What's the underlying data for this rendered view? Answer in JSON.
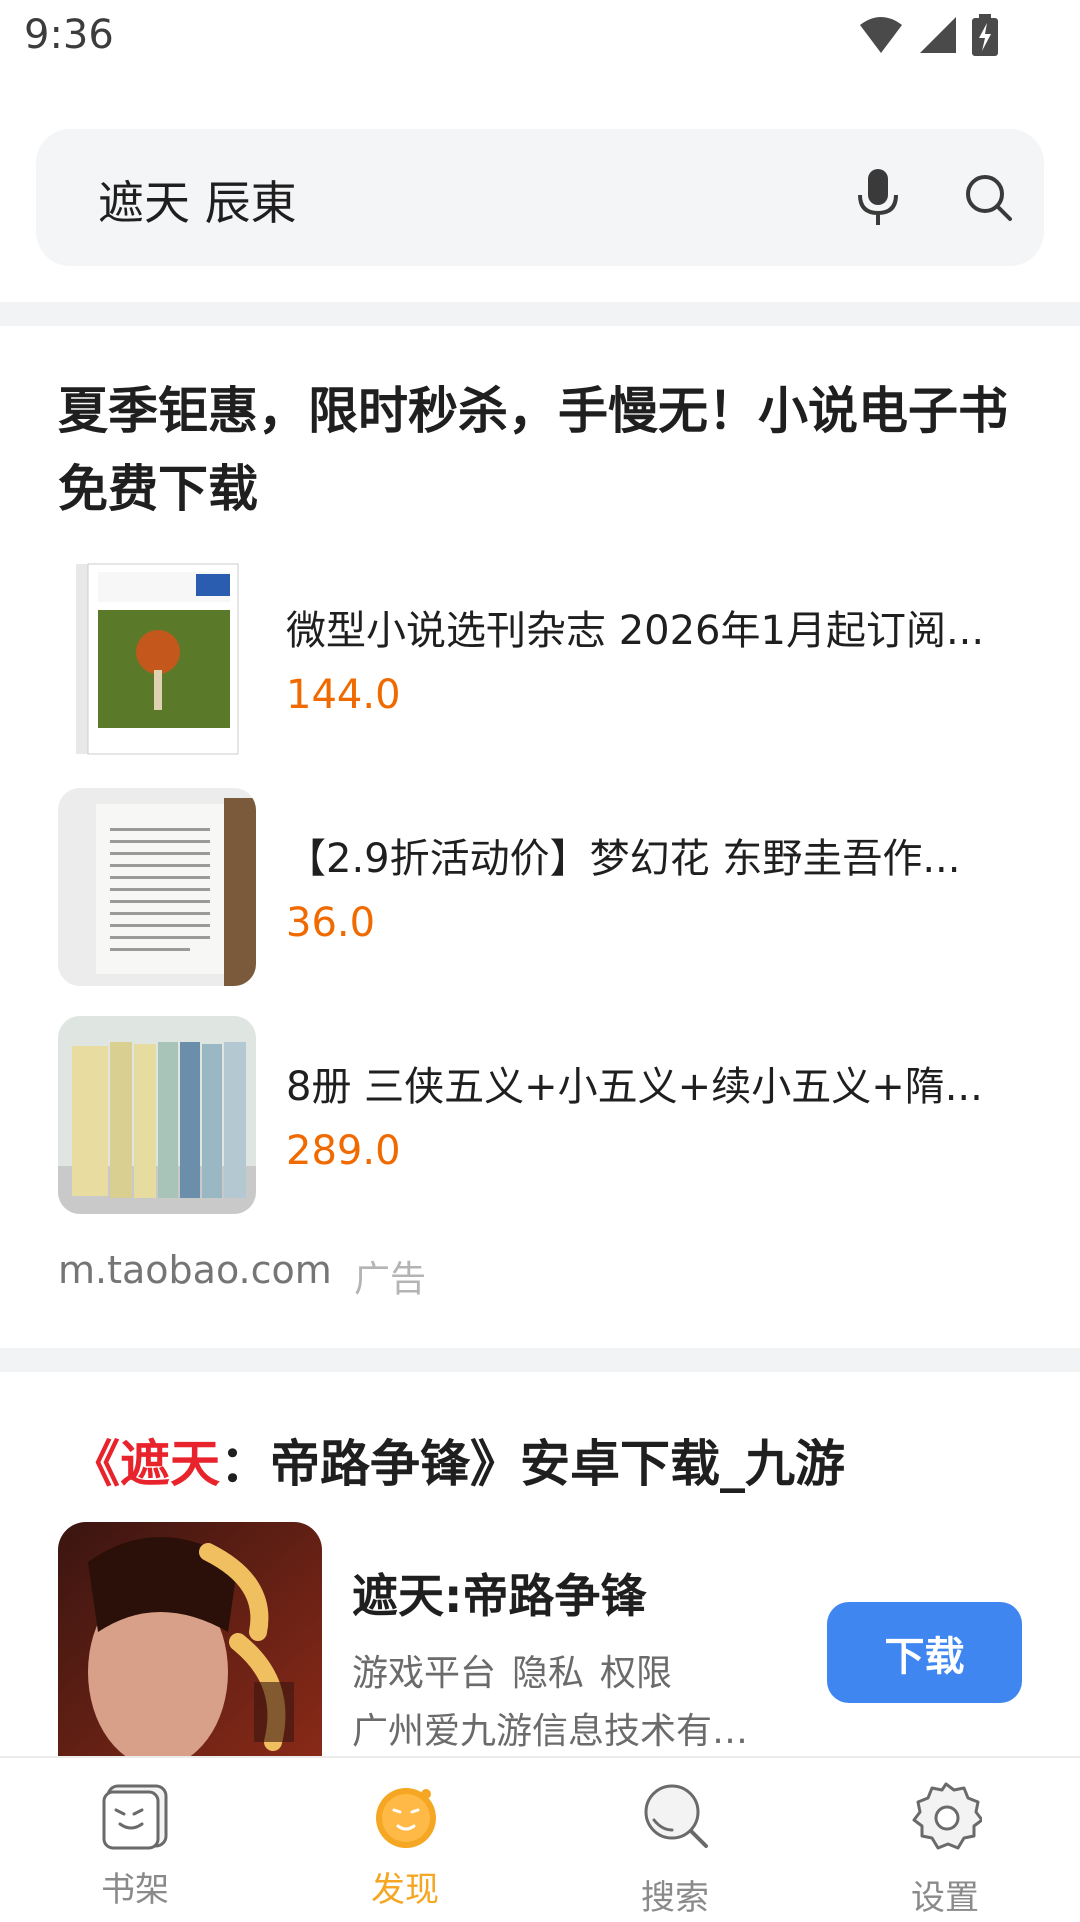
{
  "status_bar": {
    "time": "9:36"
  },
  "search": {
    "query": "遮天 辰東"
  },
  "ad": {
    "title": "夏季钜惠，限时秒杀，手慢无！小说电子书免费下载",
    "products": [
      {
        "name": "微型小说选刊杂志 2026年1月起订阅...",
        "price": "144.0"
      },
      {
        "name": "【2.9折活动价】梦幻花 东野圭吾作...",
        "price": "36.0"
      },
      {
        "name": "8册 三侠五义+小五义+续小五义+隋...",
        "price": "289.0"
      }
    ],
    "source": "m.taobao.com",
    "tag": "广告"
  },
  "game": {
    "title_open": "《",
    "title_highlight": "遮天",
    "title_rest": "：帝路争锋》安卓下载_九游",
    "name": "遮天:帝路争锋",
    "meta": [
      "游戏平台",
      "隐私",
      "权限"
    ],
    "company": "广州爱九游信息技术有限...",
    "download_label": "下载"
  },
  "nav": {
    "items": [
      {
        "label": "书架",
        "icon": "bookshelf-icon"
      },
      {
        "label": "发现",
        "icon": "discover-icon"
      },
      {
        "label": "搜索",
        "icon": "search-icon"
      },
      {
        "label": "设置",
        "icon": "settings-gear-icon"
      }
    ],
    "active_color": "#f5a623"
  },
  "colors": {
    "price": "#f06a00",
    "download_button": "#3f86f0",
    "title_highlight": "#e8232b"
  }
}
